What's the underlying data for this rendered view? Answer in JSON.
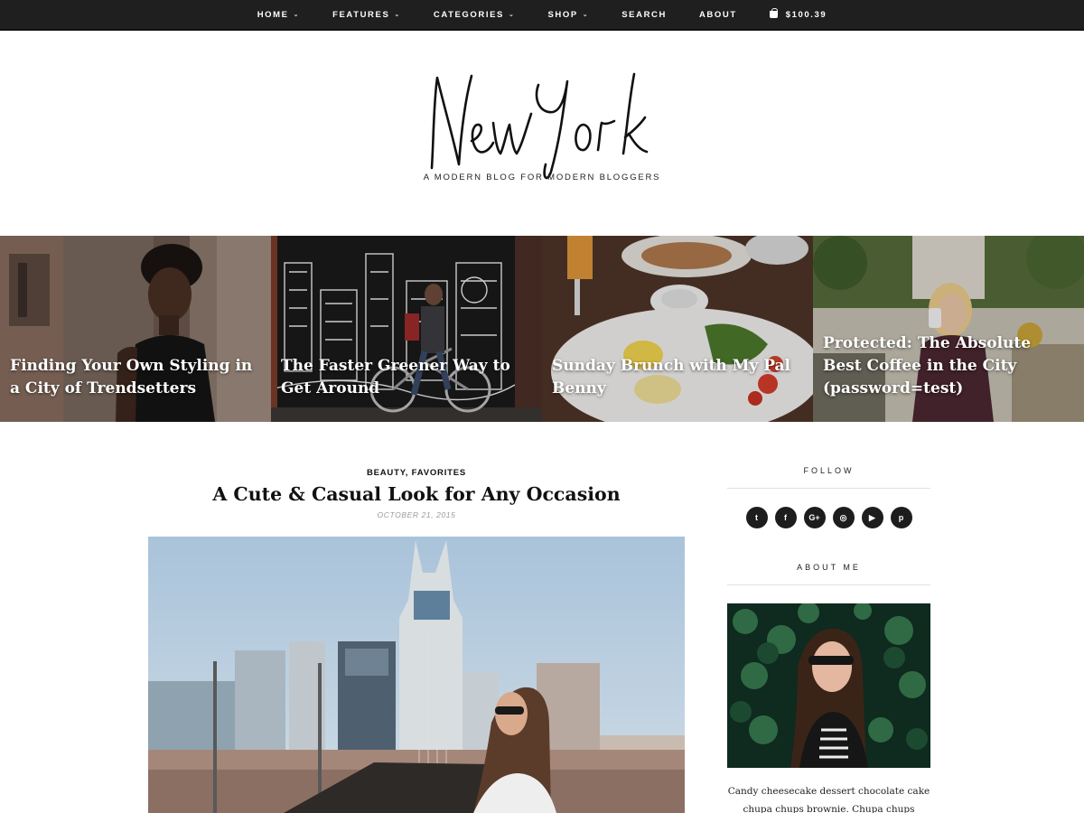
{
  "nav": {
    "items": [
      {
        "label": "HOME",
        "dropdown": true
      },
      {
        "label": "FEATURES",
        "dropdown": true
      },
      {
        "label": "CATEGORIES",
        "dropdown": true
      },
      {
        "label": "SHOP",
        "dropdown": true
      },
      {
        "label": "SEARCH",
        "dropdown": false
      },
      {
        "label": "ABOUT",
        "dropdown": false
      }
    ],
    "cart_total": "$100.39"
  },
  "brand": {
    "logo_text": "New York",
    "tagline": "A MODERN BLOG FOR MODERN BLOGGERS"
  },
  "slider": [
    {
      "title": "Finding Your Own Styling in a City of Trendsetters"
    },
    {
      "title": "The Faster Greener Way to Get Around"
    },
    {
      "title": "Sunday Brunch with My Pal Benny"
    },
    {
      "title": "Protected: The Absolute Best Coffee in the City (password=test)"
    }
  ],
  "post": {
    "categories": [
      "BEAUTY",
      "FAVORITES"
    ],
    "title": "A Cute & Casual Look for Any Occasion",
    "date": "OCTOBER 21, 2015"
  },
  "sidebar": {
    "follow_heading": "FOLLOW",
    "social": [
      {
        "icon": "twitter-icon",
        "glyph": "t"
      },
      {
        "icon": "facebook-icon",
        "glyph": "f"
      },
      {
        "icon": "google-plus-icon",
        "glyph": "G+"
      },
      {
        "icon": "instagram-icon",
        "glyph": "◎"
      },
      {
        "icon": "youtube-icon",
        "glyph": "▶"
      },
      {
        "icon": "pinterest-icon",
        "glyph": "p"
      }
    ],
    "about_heading": "ABOUT ME",
    "about_text": "Candy cheesecake dessert chocolate cake chupa chups brownie. Chupa chups pastry cotton"
  },
  "colors": {
    "nav_bg": "#1f1f1f",
    "text": "#111111",
    "muted": "#999999"
  }
}
